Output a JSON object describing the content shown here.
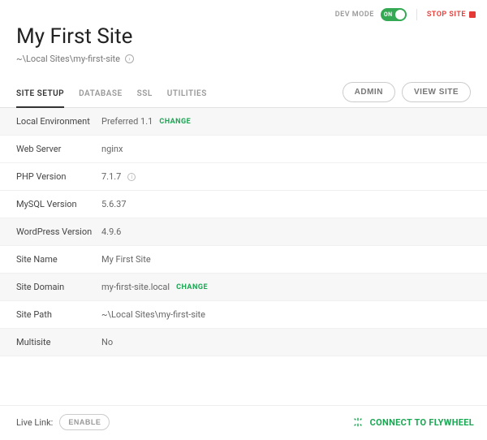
{
  "topbar": {
    "dev_mode_label": "DEV MODE",
    "toggle_text": "ON",
    "stop_label": "STOP SITE"
  },
  "header": {
    "title": "My First Site",
    "path": "~\\Local Sites\\my-first-site"
  },
  "tabs": {
    "items": [
      {
        "label": "SITE SETUP"
      },
      {
        "label": "DATABASE"
      },
      {
        "label": "SSL"
      },
      {
        "label": "UTILITIES"
      }
    ],
    "admin_label": "ADMIN",
    "view_label": "VIEW SITE"
  },
  "details": {
    "rows": [
      {
        "label": "Local Environment",
        "value": "Preferred 1.1",
        "change": "CHANGE",
        "alt": true
      },
      {
        "label": "Web Server",
        "value": "nginx"
      },
      {
        "label": "PHP Version",
        "value": "7.1.7",
        "info": true
      },
      {
        "label": "MySQL Version",
        "value": "5.6.37"
      },
      {
        "label": "WordPress Version",
        "value": "4.9.6",
        "alt": true
      },
      {
        "label": "Site Name",
        "value": "My First Site"
      },
      {
        "label": "Site Domain",
        "value": "my-first-site.local",
        "change": "CHANGE",
        "alt": true
      },
      {
        "label": "Site Path",
        "value": "~\\Local Sites\\my-first-site"
      },
      {
        "label": "Multisite",
        "value": "No",
        "alt": true
      }
    ]
  },
  "footer": {
    "live_link_label": "Live Link:",
    "enable_label": "ENABLE",
    "connect_label": "CONNECT TO FLYWHEEL"
  }
}
